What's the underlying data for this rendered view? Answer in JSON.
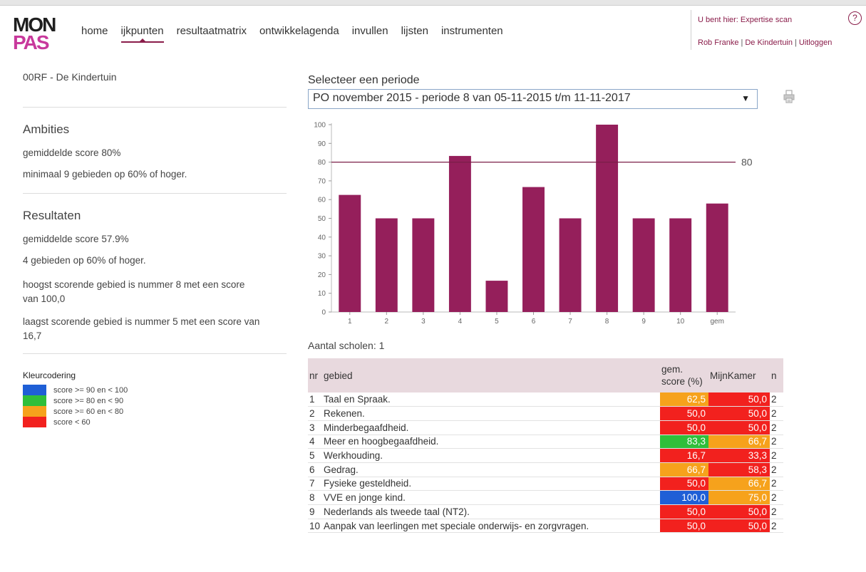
{
  "header": {
    "logo_top": "MON",
    "logo_bottom": "PAS",
    "nav": [
      "home",
      "ijkpunten",
      "resultaatmatrix",
      "ontwikkelagenda",
      "invullen",
      "lijsten",
      "instrumenten"
    ],
    "active_nav": "ijkpunten",
    "breadcrumb": "U bent hier: Expertise scan",
    "help_label": "?",
    "user": "Rob Franke",
    "school": "De Kindertuin",
    "logout": "Uitloggen"
  },
  "left": {
    "school_name": "00RF - De Kindertuin",
    "ambities_title": "Ambities",
    "ambities_line1": "gemiddelde score 80%",
    "ambities_line2": "minimaal 9 gebieden op 60% of hoger.",
    "resultaten_title": "Resultaten",
    "resultaten_line1": "gemiddelde score 57.9%",
    "resultaten_line2": "4 gebieden op 60% of hoger.",
    "hoogst": "hoogst scorende gebied is nummer 8 met een score van 100,0",
    "laagst": "laagst scorende gebied is nummer 5 met een score van 16,7",
    "legend_title": "Kleurcodering",
    "legend": [
      {
        "label": "score >= 90 en < 100",
        "color": "#1f5fd6"
      },
      {
        "label": "score >= 80 en < 90",
        "color": "#2fbf3a"
      },
      {
        "label": "score >= 60 en < 80",
        "color": "#f6a21c"
      },
      {
        "label": "score < 60",
        "color": "#f2211e"
      }
    ]
  },
  "period": {
    "label": "Selecteer een periode",
    "selected": "PO november 2015 - periode 8 van 05-11-2015 t/m 11-11-2017"
  },
  "chart_data": {
    "type": "bar",
    "categories": [
      "1",
      "2",
      "3",
      "4",
      "5",
      "6",
      "7",
      "8",
      "9",
      "10",
      "gem"
    ],
    "values": [
      62.5,
      50.0,
      50.0,
      83.3,
      16.7,
      66.7,
      50.0,
      100.0,
      50.0,
      50.0,
      57.9
    ],
    "yticks": [
      0,
      10,
      20,
      30,
      40,
      50,
      60,
      70,
      80,
      90,
      100
    ],
    "ylim": [
      0,
      100
    ],
    "reference_line": 80,
    "reference_label": "80",
    "bar_color": "#951f5b",
    "title": "",
    "xlabel": "",
    "ylabel": ""
  },
  "count_label": "Aantal scholen: 1",
  "table": {
    "headers": {
      "nr": "nr",
      "gebied": "gebied",
      "score": "gem. score (%)",
      "mijnkamer": "MijnKamer",
      "n": "n"
    },
    "rows": [
      {
        "nr": "1",
        "gebied": "Taal en Spraak.",
        "score": "62,5",
        "score_color": "#f6a21c",
        "mk": "50,0",
        "mk_color": "#f2211e",
        "n": "2"
      },
      {
        "nr": "2",
        "gebied": "Rekenen.",
        "score": "50,0",
        "score_color": "#f2211e",
        "mk": "50,0",
        "mk_color": "#f2211e",
        "n": "2"
      },
      {
        "nr": "3",
        "gebied": "Minderbegaafdheid.",
        "score": "50,0",
        "score_color": "#f2211e",
        "mk": "50,0",
        "mk_color": "#f2211e",
        "n": "2"
      },
      {
        "nr": "4",
        "gebied": "Meer en hoogbegaafdheid.",
        "score": "83,3",
        "score_color": "#2fbf3a",
        "mk": "66,7",
        "mk_color": "#f6a21c",
        "n": "2"
      },
      {
        "nr": "5",
        "gebied": "Werkhouding.",
        "score": "16,7",
        "score_color": "#f2211e",
        "mk": "33,3",
        "mk_color": "#f2211e",
        "n": "2"
      },
      {
        "nr": "6",
        "gebied": "Gedrag.",
        "score": "66,7",
        "score_color": "#f6a21c",
        "mk": "58,3",
        "mk_color": "#f2211e",
        "n": "2"
      },
      {
        "nr": "7",
        "gebied": "Fysieke gesteldheid.",
        "score": "50,0",
        "score_color": "#f2211e",
        "mk": "66,7",
        "mk_color": "#f6a21c",
        "n": "2"
      },
      {
        "nr": "8",
        "gebied": "VVE en jonge kind.",
        "score": "100,0",
        "score_color": "#1f5fd6",
        "mk": "75,0",
        "mk_color": "#f6a21c",
        "n": "2"
      },
      {
        "nr": "9",
        "gebied": "Nederlands als tweede taal (NT2).",
        "score": "50,0",
        "score_color": "#f2211e",
        "mk": "50,0",
        "mk_color": "#f2211e",
        "n": "2"
      },
      {
        "nr": "10",
        "gebied": "Aanpak van leerlingen met speciale onderwijs- en zorgvragen.",
        "score": "50,0",
        "score_color": "#f2211e",
        "mk": "50,0",
        "mk_color": "#f2211e",
        "n": "2"
      }
    ]
  }
}
